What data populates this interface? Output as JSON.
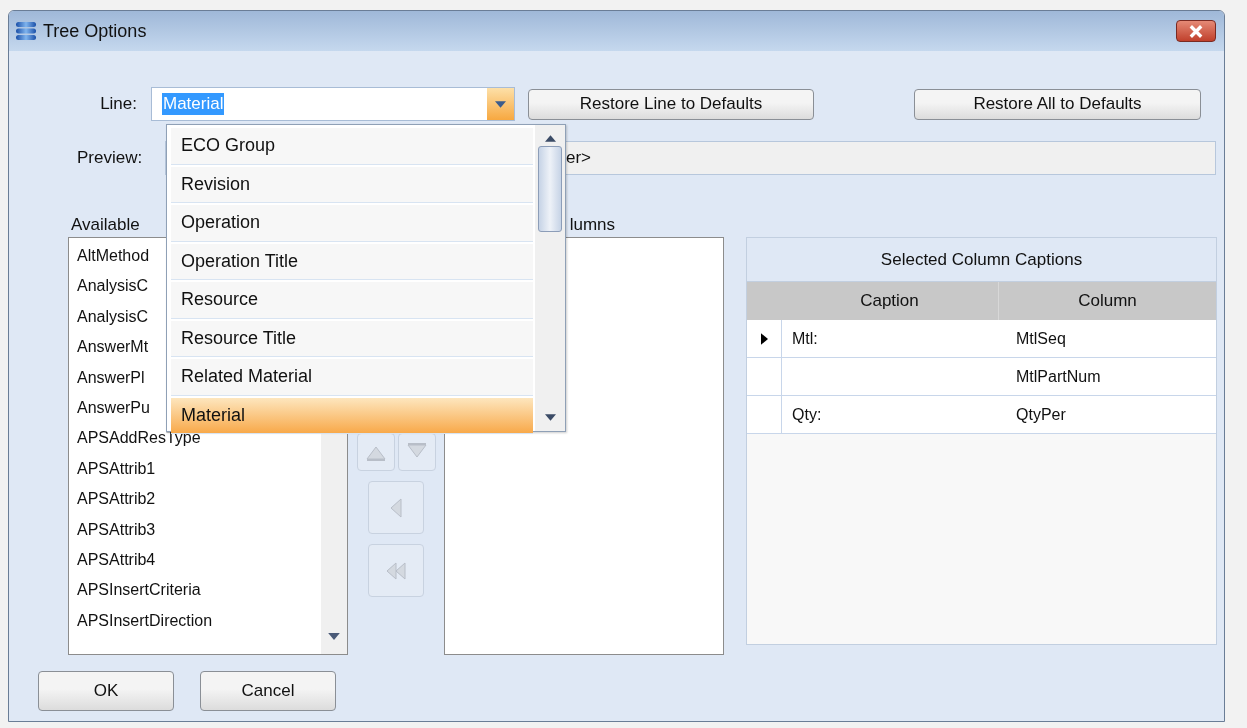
{
  "window": {
    "title": "Tree Options"
  },
  "line": {
    "label": "Line:",
    "value": "Material",
    "expanded": true,
    "options": [
      {
        "label": "ECO Group",
        "selected": false
      },
      {
        "label": "Revision",
        "selected": false
      },
      {
        "label": "Operation",
        "selected": false
      },
      {
        "label": "Operation Title",
        "selected": false
      },
      {
        "label": "Resource",
        "selected": false
      },
      {
        "label": "Resource Title",
        "selected": false
      },
      {
        "label": "Related Material",
        "selected": false
      },
      {
        "label": "Material",
        "selected": true
      }
    ]
  },
  "restore_buttons": [
    "Restore Line to Defaults",
    "Restore All to Defaults"
  ],
  "preview": {
    "label": "Preview:",
    "value": "er>"
  },
  "available_columns": {
    "label": "Available",
    "items": [
      "AltMethod",
      "AnalysisC",
      "AnalysisC",
      "AnswerMt",
      "AnswerPl",
      "AnswerPu",
      "APSAddResType",
      "APSAttrib1",
      "APSAttrib2",
      "APSAttrib3",
      "APSAttrib4",
      "APSInsertCriteria",
      "APSInsertDirection"
    ]
  },
  "selected_columns": {
    "label": "lumns"
  },
  "captions": {
    "title": "Selected Column Captions",
    "columns": [
      "Caption",
      "Column"
    ],
    "rows": [
      {
        "caption": "Mtl:",
        "column": "MtlSeq",
        "current": true
      },
      {
        "column": "MtlPartNum",
        "current": false
      },
      {
        "caption": "Qty:",
        "column": "QtyPer",
        "current": false
      }
    ]
  },
  "buttons": [
    "OK",
    "Cancel"
  ]
}
